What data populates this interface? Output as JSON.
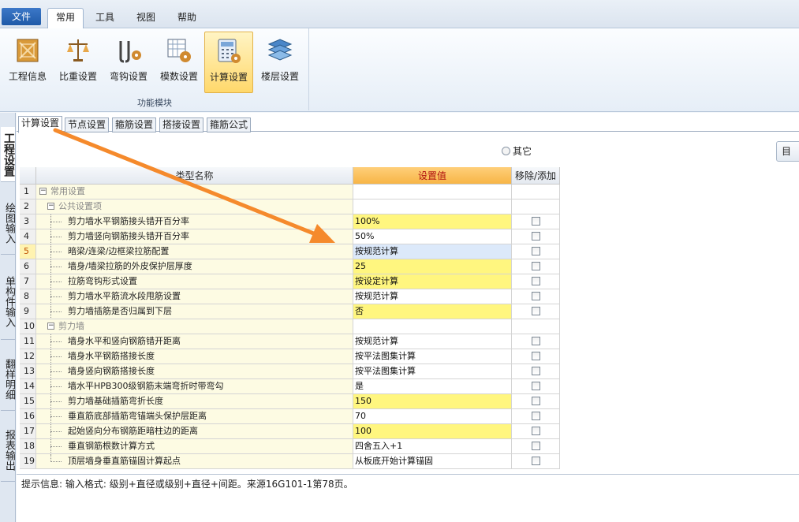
{
  "menu": {
    "file": "文件",
    "items": [
      "常用",
      "工具",
      "视图",
      "帮助"
    ]
  },
  "ribbon": {
    "buttons": [
      {
        "label": "工程信息",
        "icon": "project-info-icon"
      },
      {
        "label": "比重设置",
        "icon": "scale-icon"
      },
      {
        "label": "弯钩设置",
        "icon": "hook-settings-icon"
      },
      {
        "label": "模数设置",
        "icon": "modulus-settings-icon"
      },
      {
        "label": "计算设置",
        "icon": "calculator-icon"
      },
      {
        "label": "楼层设置",
        "icon": "floor-settings-icon"
      }
    ],
    "group_label": "功能模块"
  },
  "vtabs": [
    "工程设置",
    "绘图输入",
    "单构件输入",
    "翻样明细",
    "报表输出"
  ],
  "subtabs": [
    "计算设置",
    "节点设置",
    "箍筋设置",
    "搭接设置",
    "箍筋公式"
  ],
  "radio": {
    "label": "其它"
  },
  "side_button": "目",
  "grid": {
    "headers": {
      "name": "类型名称",
      "value": "设置值",
      "action": "移除/添加"
    },
    "rows": [
      {
        "num": "1",
        "name": "常用设置",
        "value": "",
        "level": 0,
        "group": true
      },
      {
        "num": "2",
        "name": "公共设置项",
        "value": "",
        "level": 1,
        "group": true
      },
      {
        "num": "3",
        "name": "剪力墙水平钢筋接头错开百分率",
        "value": "100%",
        "level": 2,
        "yellow": true
      },
      {
        "num": "4",
        "name": "剪力墙竖向钢筋接头错开百分率",
        "value": "50%",
        "level": 2
      },
      {
        "num": "5",
        "name": "暗梁/连梁/边框梁拉筋配置",
        "value": "按规范计算",
        "level": 2,
        "selected": true
      },
      {
        "num": "6",
        "name": "墙身/墙梁拉筋的外皮保护层厚度",
        "value": "25",
        "level": 2,
        "yellow": true
      },
      {
        "num": "7",
        "name": "拉筋弯钩形式设置",
        "value": "按设定计算",
        "level": 2,
        "yellow": true
      },
      {
        "num": "8",
        "name": "剪力墙水平筋流水段甩筋设置",
        "value": "按规范计算",
        "level": 2
      },
      {
        "num": "9",
        "name": "剪力墙插筋是否归属到下层",
        "value": "否",
        "level": 2,
        "yellow": true
      },
      {
        "num": "10",
        "name": "剪力墙",
        "value": "",
        "level": 1,
        "group": true
      },
      {
        "num": "11",
        "name": "墙身水平和竖向钢筋错开距离",
        "value": "按规范计算",
        "level": 2
      },
      {
        "num": "12",
        "name": "墙身水平钢筋搭接长度",
        "value": "按平法图集计算",
        "level": 2
      },
      {
        "num": "13",
        "name": "墙身竖向钢筋搭接长度",
        "value": "按平法图集计算",
        "level": 2
      },
      {
        "num": "14",
        "name": "墙水平HPB300级钢筋末端弯折时带弯勾",
        "value": "是",
        "level": 2
      },
      {
        "num": "15",
        "name": "剪力墙基础插筋弯折长度",
        "value": "150",
        "level": 2,
        "yellow": true
      },
      {
        "num": "16",
        "name": "垂直筋底部插筋弯锚端头保护层距离",
        "value": "70",
        "level": 2
      },
      {
        "num": "17",
        "name": "起始竖向分布钢筋距暗柱边的距离",
        "value": "100",
        "level": 2,
        "yellow": true
      },
      {
        "num": "18",
        "name": "垂直钢筋根数计算方式",
        "value": "四舍五入+1",
        "level": 2
      },
      {
        "num": "19",
        "name": "顶层墙身垂直筋锚固计算起点",
        "value": "从板底开始计算锚固",
        "level": 2
      }
    ]
  },
  "hint": "提示信息: 输入格式: 级别+直径或级别+直径+间距。来源16G101-1第78页。",
  "colors": {
    "accent": "#f58a2c",
    "value_header": "#f7b546",
    "yellow_cell": "#fff67f"
  }
}
